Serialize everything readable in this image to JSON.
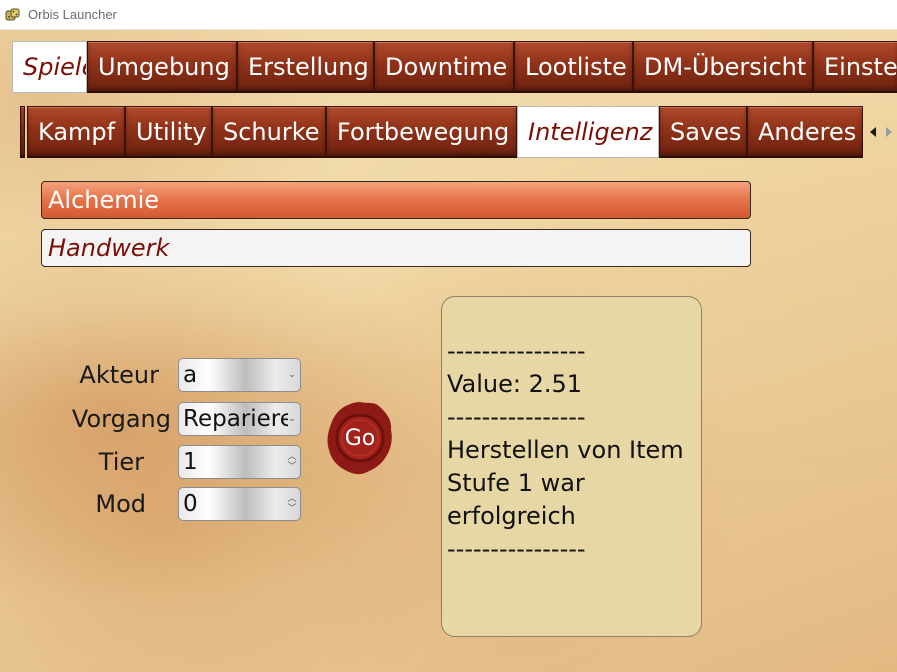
{
  "window": {
    "title": "Orbis Launcher",
    "icon": "dice-icon"
  },
  "top_tabs": [
    {
      "label": "Spieler",
      "active": true
    },
    {
      "label": "Umgebung",
      "active": false
    },
    {
      "label": "Erstellung",
      "active": false
    },
    {
      "label": "Downtime",
      "active": false
    },
    {
      "label": "Lootliste",
      "active": false
    },
    {
      "label": "DM-Übersicht",
      "active": false
    },
    {
      "label": "Einstellungen",
      "active": false
    }
  ],
  "sub_tabs": [
    {
      "label": "Kampf",
      "active": false
    },
    {
      "label": "Utility",
      "active": false
    },
    {
      "label": "Schurke",
      "active": false
    },
    {
      "label": "Fortbewegung",
      "active": false
    },
    {
      "label": "Intelligenz",
      "active": true
    },
    {
      "label": "Saves",
      "active": false
    },
    {
      "label": "Anderes",
      "active": false
    }
  ],
  "scroll_arrows": {
    "left": "◀",
    "right": "▶"
  },
  "list": [
    {
      "label": "Alchemie",
      "state": "selected"
    },
    {
      "label": "Handwerk",
      "state": "normal"
    }
  ],
  "form": {
    "akteur": {
      "label": "Akteur",
      "value": "a"
    },
    "vorgang": {
      "label": "Vorgang",
      "value": "Reparieren"
    },
    "tier": {
      "label": "Tier",
      "value": "1"
    },
    "mod": {
      "label": "Mod",
      "value": "0"
    }
  },
  "go_button": {
    "label": "Go",
    "icon": "wax-seal-icon"
  },
  "output": {
    "separator1": "----------------",
    "value_line": "Value: 2.51",
    "separator2": "----------------",
    "message": "Herstellen von Item Stufe 1 war erfolgreich",
    "separator3": "----------------"
  },
  "colors": {
    "tab_bg": "#8f3219",
    "active_text": "#7a0f06",
    "selected_item": "#e46f45",
    "output_bg": "#e6d7a5",
    "seal": "#8e1a16"
  }
}
